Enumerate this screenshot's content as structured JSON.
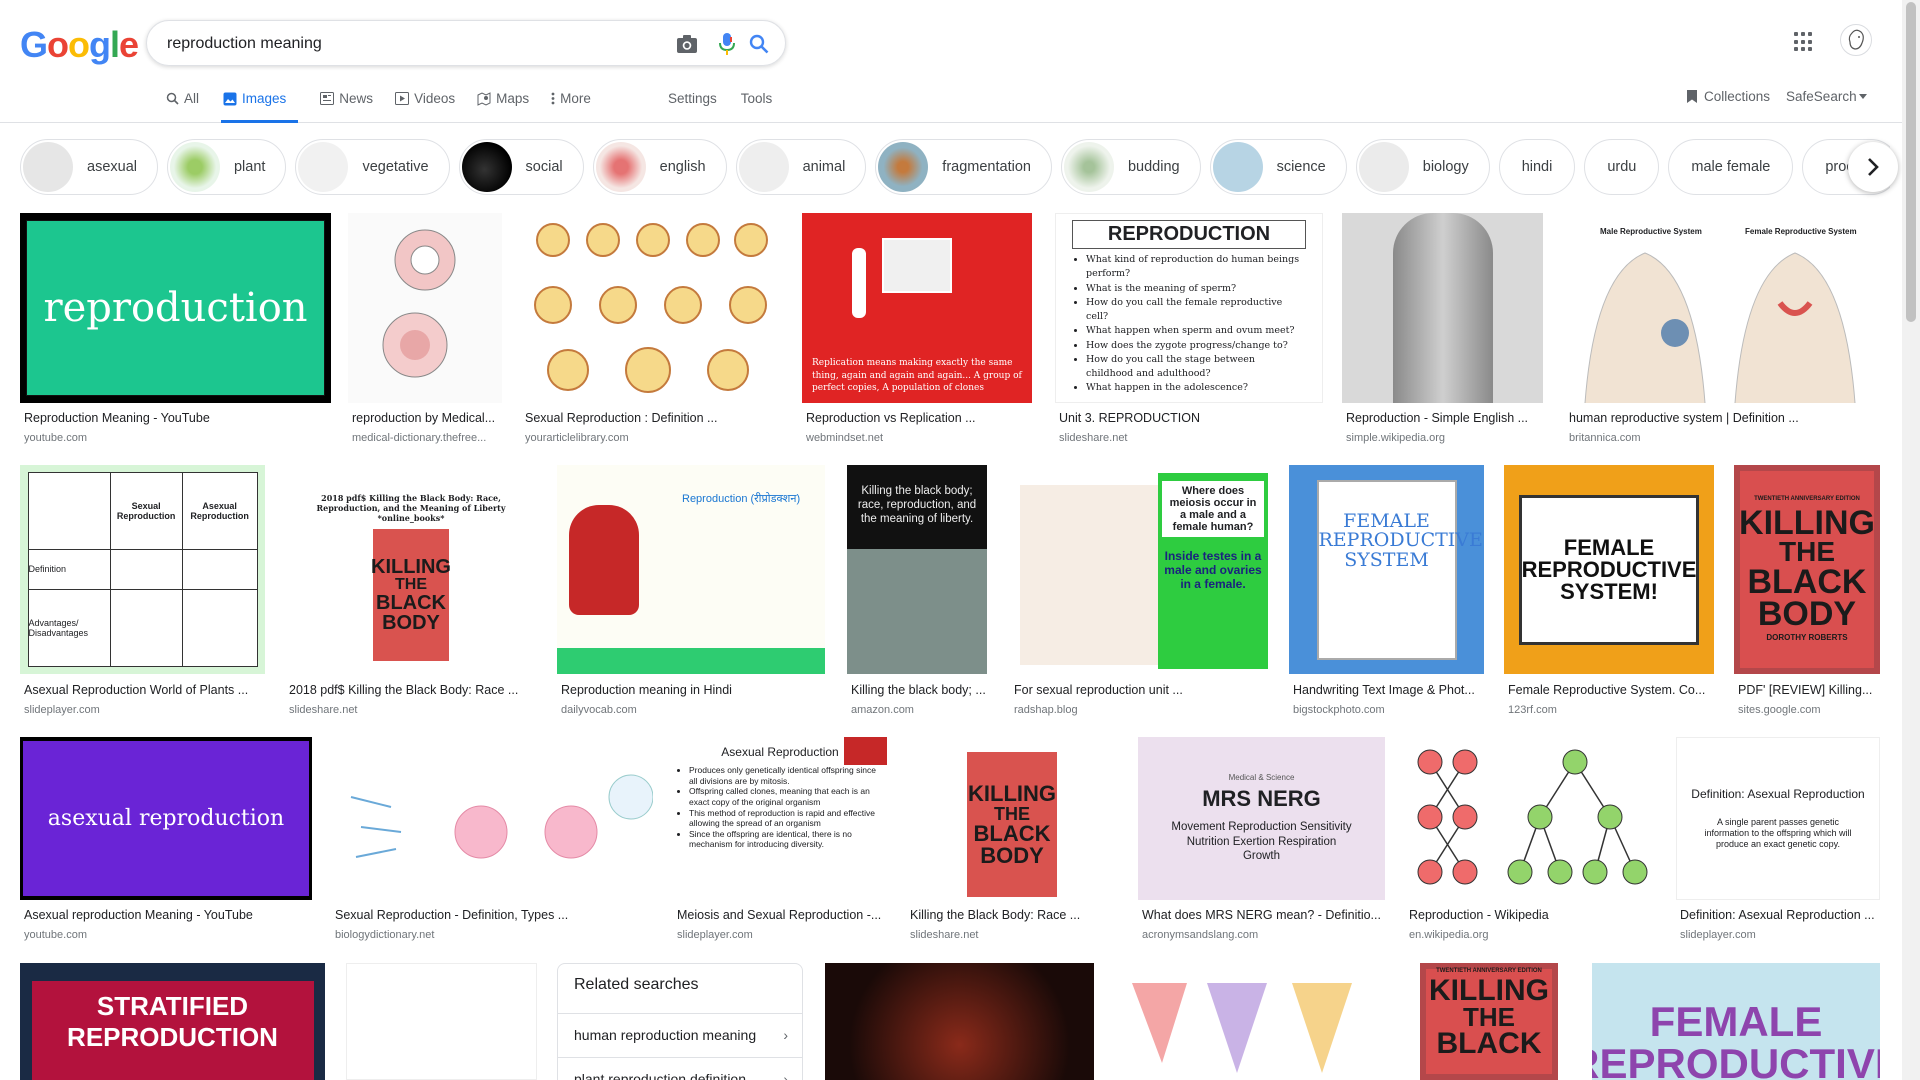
{
  "logo": {
    "letters": [
      "G",
      "o",
      "o",
      "g",
      "l",
      "e"
    ],
    "colors": [
      "#4285f4",
      "#ea4335",
      "#fbbc05",
      "#4285f4",
      "#34a853",
      "#ea4335"
    ]
  },
  "search": {
    "query": "reproduction meaning"
  },
  "icons": {
    "camera": "camera-icon",
    "mic": "mic-icon",
    "search": "search-icon",
    "apps": "apps-grid-icon",
    "avatar": "avatar-icon"
  },
  "tabs": [
    {
      "label": "All",
      "icon": "search-icon"
    },
    {
      "label": "Images",
      "icon": "image-icon",
      "active": true
    },
    {
      "label": "News",
      "icon": "news-icon"
    },
    {
      "label": "Videos",
      "icon": "video-icon"
    },
    {
      "label": "Maps",
      "icon": "map-icon"
    },
    {
      "label": "More",
      "icon": "more-vert-icon"
    }
  ],
  "toolbar": {
    "settings": "Settings",
    "tools": "Tools",
    "collections": "Collections",
    "safesearch": "SafeSearch"
  },
  "chips": [
    {
      "label": "asexual",
      "thumb": "#e8e8e8"
    },
    {
      "label": "plant",
      "thumb": "#d9ead3"
    },
    {
      "label": "vegetative",
      "thumb": "#f2f2f2"
    },
    {
      "label": "social",
      "thumb": "#111111"
    },
    {
      "label": "english",
      "thumb": "#f4d7d2"
    },
    {
      "label": "animal",
      "thumb": "#eeeeee"
    },
    {
      "label": "fragmentation",
      "thumb": "#a3bcc7"
    },
    {
      "label": "budding",
      "thumb": "#e6efe4"
    },
    {
      "label": "science",
      "thumb": "#bcd9e8"
    },
    {
      "label": "biology",
      "thumb": "#ececec"
    },
    {
      "label": "hindi"
    },
    {
      "label": "urdu"
    },
    {
      "label": "male female"
    },
    {
      "label": "process"
    }
  ],
  "results": {
    "r1": [
      {
        "caption": "Reproduction Meaning - YouTube",
        "source": "youtube.com",
        "text": "reproduction"
      },
      {
        "caption": "reproduction by Medical...",
        "source": "medical-dictionary.thefree..."
      },
      {
        "caption": "Sexual Reproduction : Definition ...",
        "source": "yourarticlelibrary.com"
      },
      {
        "caption": "Reproduction vs Replication ...",
        "source": "webmindset.net",
        "text": "Replication means making exactly the same thing, again and again and again... A group of perfect copies, A population of clones"
      },
      {
        "caption": "Unit 3. REPRODUCTION",
        "source": "slideshare.net",
        "title": "REPRODUCTION",
        "lines": [
          "What kind of reproduction do human beings perform?",
          "What is the meaning of sperm?",
          "How do you call the female reproductive cell?",
          "What happen when sperm and ovum meet?",
          "How does the zygote progress/change to?",
          "How do you call the stage between childhood and adulthood?",
          "What happen in the adolescence?"
        ]
      },
      {
        "caption": "Reproduction - Simple English ...",
        "source": "simple.wikipedia.org"
      },
      {
        "caption": "human reproductive system | Definition ...",
        "source": "britannica.com",
        "labels": [
          "Male Reproductive System",
          "Female Reproductive System"
        ]
      }
    ],
    "r2": [
      {
        "caption": "Asexual Reproduction World of Plants ...",
        "source": "slideplayer.com",
        "table": {
          "cols": [
            "Sexual Reproduction",
            "Asexual Reproduction"
          ],
          "rows": [
            "Definition",
            "Advantages/ Disadvantages"
          ]
        }
      },
      {
        "caption": "2018 pdf$ Killing the Black Body: Race ...",
        "source": "slideshare.net",
        "text": "2018 pdf$ Killing the Black Body: Race, Reproduction, and the Meaning of Liberty *online_books*"
      },
      {
        "caption": "Reproduction meaning in Hindi",
        "source": "dailyvocab.com",
        "text": "Reproduction (रीप्रोडक्शन)"
      },
      {
        "caption": "Killing the black body; ...",
        "source": "amazon.com",
        "text": "Killing the black body; race, reproduction, and the meaning of liberty."
      },
      {
        "caption": "For sexual reproduction unit ...",
        "source": "radshap.blog",
        "text": "Where does meiosis occur in a male and a female human?",
        "answer": "Inside testes in a male and ovaries in a female."
      },
      {
        "caption": "Handwriting Text Image & Phot...",
        "source": "bigstockphoto.com",
        "text": "FEMALE REPRODUCTIVE SYSTEM"
      },
      {
        "caption": "Female Reproductive System. Co...",
        "source": "123rf.com",
        "text": "FEMALE REPRODUCTIVE SYSTEM!"
      },
      {
        "caption": "PDF' [REVIEW] Killing...",
        "source": "sites.google.com"
      }
    ],
    "r3": [
      {
        "caption": "Asexual reproduction Meaning - YouTube",
        "source": "youtube.com",
        "text": "asexual reproduction"
      },
      {
        "caption": "Sexual Reproduction - Definition, Types ...",
        "source": "biologydictionary.net"
      },
      {
        "caption": "Meiosis and Sexual Reproduction -...",
        "source": "slideplayer.com",
        "title": "Asexual Reproduction",
        "lines": [
          "Produces only genetically identical offspring since all divisions are by mitosis.",
          "Offspring called clones, meaning that each is an exact copy of the original organism",
          "This method of reproduction is rapid and effective allowing the spread of an organism",
          "Since the offspring are identical, there is no mechanism for introducing diversity."
        ]
      },
      {
        "caption": "Killing the Black Body: Race ...",
        "source": "slideshare.net"
      },
      {
        "caption": "What does MRS NERG mean? - Definitio...",
        "source": "acronymsandslang.com",
        "title": "MRS NERG",
        "sub": "Medical & Science",
        "text": "Movement Reproduction Sensitivity Nutrition Exertion Respiration Growth"
      },
      {
        "caption": "Reproduction - Wikipedia",
        "source": "en.wikipedia.org"
      },
      {
        "caption": "Definition: Asexual Reproduction ...",
        "source": "slideplayer.com",
        "title": "Definition: Asexual Reproduction",
        "text": "A single parent passes genetic information to the offspring which will produce an exact genetic copy."
      }
    ],
    "r4": [
      {
        "text": "STRATIFIED REPRODUCTION"
      },
      {
        "text": ""
      },
      {
        "text": ""
      },
      {
        "text": ""
      },
      {
        "text": ""
      },
      {
        "text": "FEMALE REPRODUCTIVE"
      }
    ]
  },
  "book": {
    "top": "TWENTIETH ANNIVERSARY EDITION",
    "line1": "KILLING",
    "line2": "THE",
    "line3": "BLACK",
    "line4": "BODY",
    "author": "DOROTHY ROBERTS"
  },
  "related": {
    "title": "Related searches",
    "items": [
      "human reproduction meaning",
      "plant reproduction definition"
    ]
  }
}
